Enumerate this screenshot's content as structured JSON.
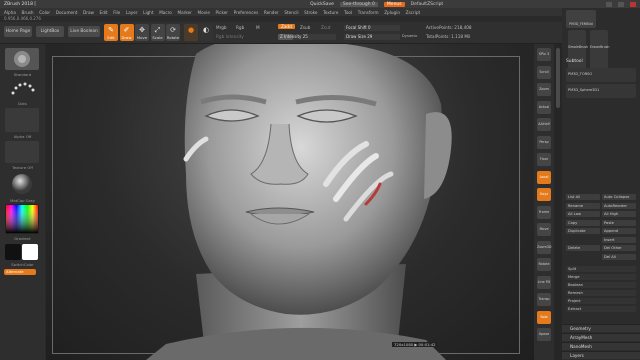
{
  "titlebar": {
    "title": "ZBrush 2018 [",
    "quicksave": "QuickSave",
    "see_through": "See-through 0",
    "menus": "Menus",
    "default_script": "DefaultZScript"
  },
  "menubar": [
    "Alpha",
    "Brush",
    "Color",
    "Document",
    "Draw",
    "Edit",
    "File",
    "Layer",
    "Light",
    "Macro",
    "Marker",
    "Movie",
    "Picker",
    "Preferences",
    "Render",
    "Stencil",
    "Stroke",
    "Texture",
    "Tool",
    "Transform",
    "Zplugin",
    "Zscript"
  ],
  "status_text": "0.956,0.466,0.276",
  "shelf": {
    "home_page": "Home Page",
    "lightbox": "LightBox",
    "live_boolean": "Live Boolean",
    "tools": [
      {
        "label": "Edit",
        "glyph": "✎",
        "active": true
      },
      {
        "label": "Draw",
        "glyph": "✐",
        "active": true
      },
      {
        "label": "Move",
        "glyph": "✥",
        "active": false
      },
      {
        "label": "Scale",
        "glyph": "⤢",
        "active": false
      },
      {
        "label": "Rotate",
        "glyph": "⟳",
        "active": false
      }
    ],
    "mrgb": "Mrgb",
    "rgb": "Rgb",
    "m": "M",
    "rgb_intensity": "Rgb Intensity",
    "zadd": "Zadd",
    "zsub": "Zsub",
    "zcut": "Zcut",
    "z_intensity": "Z Intensity 25",
    "z_intensity_value": 25,
    "focal_shift": "Focal Shift 0",
    "draw_size": "Draw Size 29",
    "dynamic": "Dynamic",
    "active_points": "ActivePoints: 218,408",
    "total_points": "TotalPoints: 1.118 Mil"
  },
  "left": {
    "brush": "Standard",
    "stroke": "Dots",
    "alpha": "Alpha Off",
    "texture": "Texture Off",
    "material": "MatCap Gray",
    "gradient": "Gradient",
    "switch_color": "SwitchColor",
    "alternate": "Alternate"
  },
  "dock": [
    {
      "label": "SPix 3",
      "active": false
    },
    {
      "label": "Scroll",
      "active": false
    },
    {
      "label": "Zoom",
      "active": false
    },
    {
      "label": "Actual",
      "active": false
    },
    {
      "label": "AAHalf",
      "active": false
    },
    {
      "label": "Persp",
      "active": false
    },
    {
      "label": "Floor",
      "active": false
    },
    {
      "label": "Local",
      "active": true
    },
    {
      "label": "Gxyz",
      "active": true
    },
    {
      "label": "Frame",
      "active": false
    },
    {
      "label": "Move",
      "active": false
    },
    {
      "label": "Zoom3D",
      "active": false
    },
    {
      "label": "Rotate",
      "active": false
    },
    {
      "label": "Line Fill",
      "active": false
    },
    {
      "label": "Transp",
      "active": false
    },
    {
      "label": "Solo",
      "active": true
    },
    {
      "label": "Xpose",
      "active": false
    }
  ],
  "rpanel": {
    "brushes": [
      "PM3D_FEMB4d",
      "SimpleBrush",
      "EraserBrush",
      "PM3D_TORSO",
      "PM3D_Sphere3D1"
    ],
    "subtool": "Subtool",
    "rows": [
      [
        "List All",
        "Auto Collapse"
      ],
      [
        "Rename",
        "AutoReorder"
      ],
      [
        "All Low",
        "All High"
      ],
      [
        "Copy",
        "Paste"
      ],
      [
        "Duplicate",
        "Append"
      ],
      [
        "",
        "Insert"
      ],
      [
        "Delete",
        "Del Other"
      ],
      [
        "",
        "Del All"
      ]
    ],
    "actions": [
      "Split",
      "Merge",
      "Boolean",
      "Remesh",
      "Project",
      "Extract"
    ],
    "sections": [
      "Geometry",
      "ArrayMesh",
      "NanoMesh",
      "Layers"
    ]
  },
  "viewport": {
    "hud": "720x1080  ▶  00:01:42"
  },
  "colors": {
    "accent": "#e47a1b",
    "active_brush_color": "#ffffff",
    "secondary_color": "#000000"
  }
}
